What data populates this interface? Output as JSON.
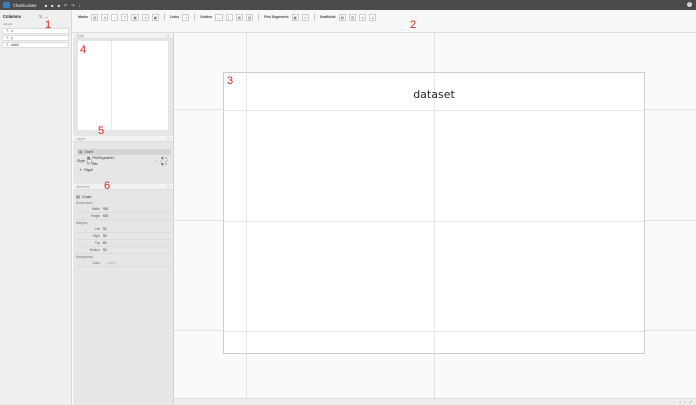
{
  "app": {
    "title": "Charticulator",
    "menu_icons": [
      "■",
      "■",
      "■",
      "↶",
      "↷",
      "↓"
    ],
    "help_glyph": "?"
  },
  "columns": {
    "title": "Columns",
    "tools": [
      "⇅",
      "—"
    ],
    "dataset_label": "default",
    "items": [
      {
        "label": "x"
      },
      {
        "label": "y"
      },
      {
        "label": "width"
      }
    ]
  },
  "toolbar": {
    "marks_label": "Marks",
    "marks_buttons": [
      "▥",
      "⊙",
      "∕",
      "T",
      "▦",
      "↗",
      "▣"
    ],
    "links_label": "Links",
    "links_buttons": [
      "⤳"
    ],
    "guides_label": "Guides",
    "guides_buttons": [
      "—",
      "│",
      "▤",
      "▥"
    ],
    "plot_segments_label": "Plot Segments",
    "plot_segments_buttons": [
      "▦",
      "∿"
    ],
    "scaffolds_label": "Scaffolds",
    "scaffolds_buttons": [
      "▤",
      "▥",
      "◎",
      "∠"
    ]
  },
  "glyph_panel": {
    "header": "Glyph",
    "footer_label": "Glyph",
    "footer_add": "+",
    "footer_tools": "⌕ ⌕ ⤢"
  },
  "layers_panel": {
    "header": "Layers",
    "items": [
      {
        "label": "Chart",
        "icon": "▤",
        "right": ""
      },
      {
        "label": "PlotSegment1",
        "icon": "▦",
        "right": "◉ ≡"
      },
      {
        "label": "Title",
        "icon": "T",
        "right": "◉ ≡"
      },
      {
        "label": "Glyph",
        "icon": "✦",
        "right": ""
      }
    ]
  },
  "attributes_panel": {
    "header": "Attributes",
    "chart_label": "Chart",
    "sections": [
      {
        "title": "Dimensions",
        "rows": [
          {
            "label": "Width",
            "value": "900"
          },
          {
            "label": "Height",
            "value": "600"
          }
        ]
      },
      {
        "title": "Margins",
        "rows": [
          {
            "label": "Left",
            "value": "50"
          },
          {
            "label": "Right",
            "value": "50"
          },
          {
            "label": "Top",
            "value": "80"
          },
          {
            "label": "Bottom",
            "value": "50"
          }
        ]
      },
      {
        "title": "Background",
        "rows": [
          {
            "label": "Color",
            "value": "(none)",
            "muted": true
          }
        ]
      }
    ]
  },
  "canvas": {
    "chart_title": "dataset",
    "footer_tools": "⌕ ⌕ ⤢"
  },
  "annotations": [
    "1",
    "2",
    "3",
    "4",
    "5",
    "6"
  ],
  "colors": {
    "appbar": "#4a4a4a",
    "annotation_red": "#e02020",
    "panel_bg": "#e6e6e6"
  }
}
